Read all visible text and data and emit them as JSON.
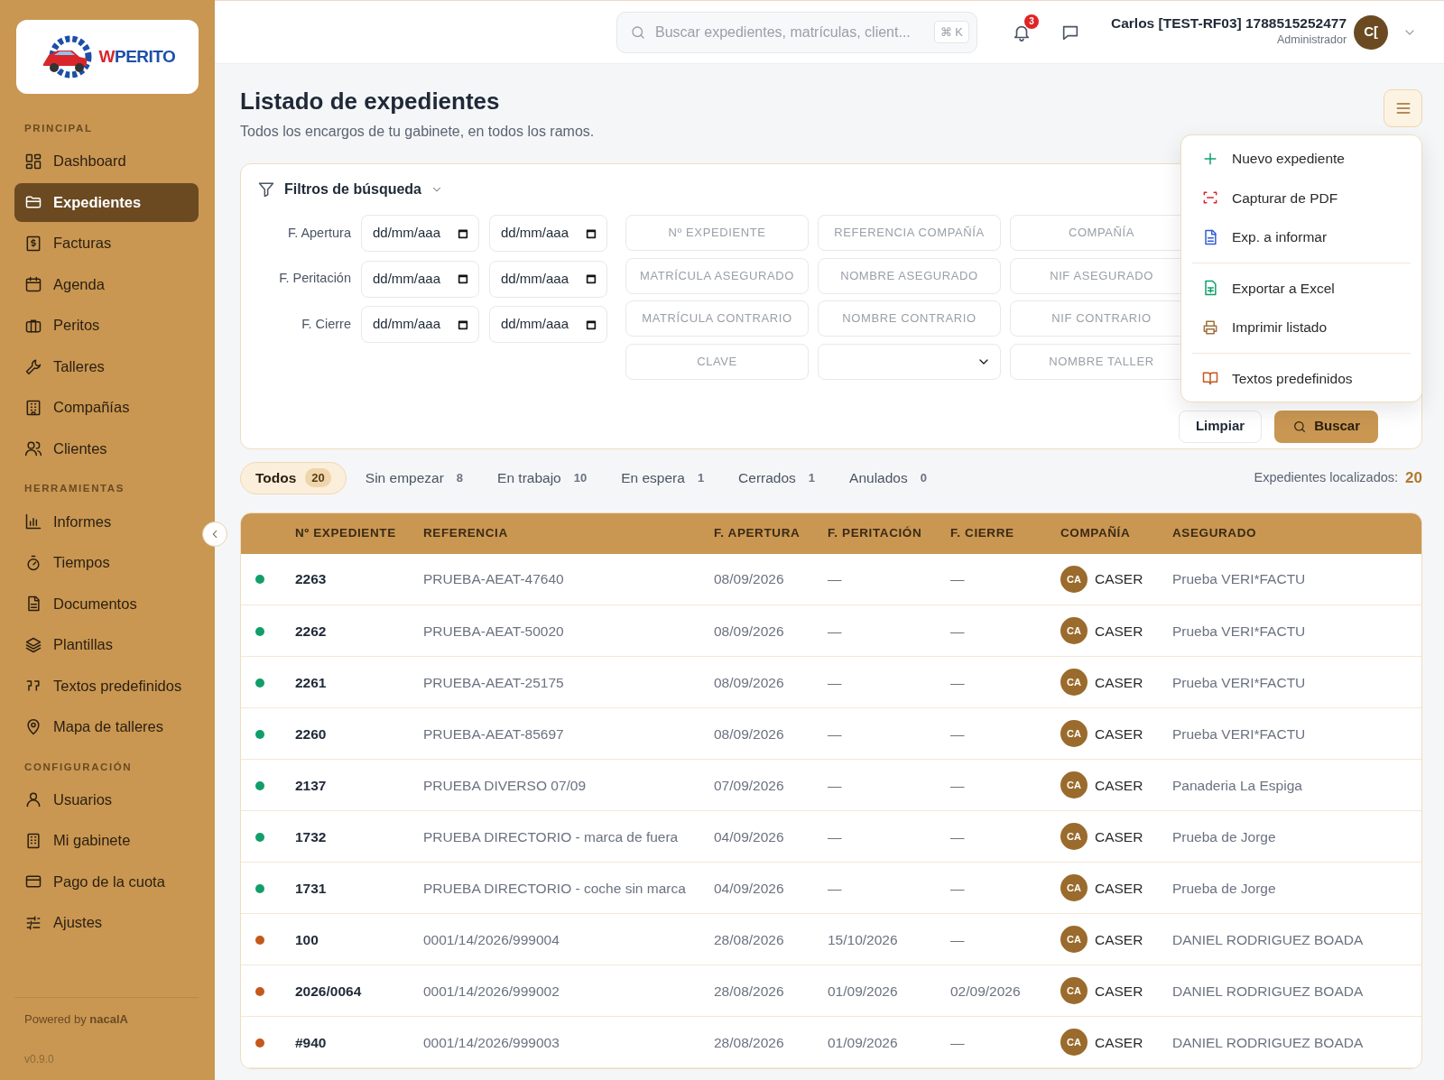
{
  "sidebar": {
    "logo": {
      "mark": "W",
      "text": "PERITO"
    },
    "sections": [
      {
        "title": "PRINCIPAL",
        "items": [
          {
            "label": "Dashboard",
            "selected": false
          },
          {
            "label": "Expedientes",
            "selected": true
          },
          {
            "label": "Facturas",
            "selected": false
          },
          {
            "label": "Agenda",
            "selected": false
          },
          {
            "label": "Peritos",
            "selected": false
          },
          {
            "label": "Talleres",
            "selected": false
          },
          {
            "label": "Compañías",
            "selected": false
          },
          {
            "label": "Clientes",
            "selected": false
          }
        ]
      },
      {
        "title": "HERRAMIENTAS",
        "items": [
          {
            "label": "Informes",
            "selected": false
          },
          {
            "label": "Tiempos",
            "selected": false
          },
          {
            "label": "Documentos",
            "selected": false
          },
          {
            "label": "Plantillas",
            "selected": false
          },
          {
            "label": "Textos predefinidos",
            "selected": false
          },
          {
            "label": "Mapa de talleres",
            "selected": false
          }
        ]
      },
      {
        "title": "CONFIGURACIÓN",
        "items": [
          {
            "label": "Usuarios",
            "selected": false
          },
          {
            "label": "Mi gabinete",
            "selected": false
          },
          {
            "label": "Pago de la cuota",
            "selected": false
          },
          {
            "label": "Ajustes",
            "selected": false
          }
        ]
      }
    ],
    "powered_by": "Powered by **nacalA**",
    "version": "v0.9.0"
  },
  "header": {
    "search": {
      "placeholder": "Buscar expedientes, matrículas, client...",
      "shortcut": "⌘ K"
    },
    "notifications": "3",
    "user": {
      "name": "Carlos [TEST-RF03] 1788515252477",
      "role": "Administrador",
      "initials": "C["
    }
  },
  "page": {
    "title": "Listado de expedientes",
    "subtitle": "Todos los encargos de tu gabinete, en todos los ramos."
  },
  "filters": {
    "title": "Filtros de búsqueda",
    "date_rows": [
      {
        "label": "F. Apertura",
        "from": "dd/mm/aaa",
        "to": "dd/mm/aaa"
      },
      {
        "label": "F. Peritación",
        "from": "dd/mm/aaa",
        "to": "dd/mm/aaa"
      },
      {
        "label": "F. Cierre",
        "from": "dd/mm/aaa",
        "to": "dd/mm/aaa"
      }
    ],
    "fields": [
      {
        "kind": "text",
        "placeholder": "Nº EXPEDIENTE"
      },
      {
        "kind": "text",
        "placeholder": "REFERENCIA COMPAÑÍA"
      },
      {
        "kind": "text",
        "placeholder": "COMPAÑÍA"
      },
      {
        "kind": "text",
        "placeholder": "MATRÍCULA ASEGURADO"
      },
      {
        "kind": "text",
        "placeholder": "NOMBRE ASEGURADO"
      },
      {
        "kind": "text",
        "placeholder": "NIF ASEGURADO"
      },
      {
        "kind": "text",
        "placeholder": "MATRÍCULA CONTRARIO"
      },
      {
        "kind": "text",
        "placeholder": "NOMBRE CONTRARIO"
      },
      {
        "kind": "text",
        "placeholder": "NIF CONTRARIO"
      },
      {
        "kind": "text",
        "placeholder": "CLAVE"
      },
      {
        "kind": "select"
      },
      {
        "kind": "text",
        "placeholder": "NOMBRE TALLER"
      }
    ],
    "buttons": [
      "Limpiar",
      "Buscar"
    ]
  },
  "actions_menu": {
    "groups": [
      [
        "Nuevo expediente",
        "Capturar de PDF",
        "Exp. a informar"
      ],
      [
        "Exportar a Excel",
        "Imprimir listado"
      ],
      [
        "Textos predefinidos"
      ]
    ]
  },
  "tabs": [
    {
      "label": "Todos",
      "count": "20",
      "selected": true
    },
    {
      "label": "Sin empezar",
      "count": "8",
      "selected": false
    },
    {
      "label": "En trabajo",
      "count": "10",
      "selected": false
    },
    {
      "label": "En espera",
      "count": "1",
      "selected": false
    },
    {
      "label": "Cerrados",
      "count": "1",
      "selected": false
    },
    {
      "label": "Anulados",
      "count": "0",
      "selected": false
    }
  ],
  "found": {
    "label": "Expedientes localizados:",
    "count": "20"
  },
  "table": {
    "columns": [
      "Nº EXPEDIENTE",
      "REFERENCIA",
      "F. APERTURA",
      "F. PERITACIÓN",
      "F. CIERRE",
      "COMPAÑÍA",
      "ASEGURADO"
    ],
    "rows": [
      {
        "color": "#129e6a",
        "number": "2263",
        "reference": "PRUEBA-AEAT-47640",
        "opened": "08/09/2026",
        "appraised": "—",
        "closed": "—",
        "company_initials": "CA",
        "company": "CASER",
        "insured": "Prueba VERI*FACTU"
      },
      {
        "color": "#129e6a",
        "number": "2262",
        "reference": "PRUEBA-AEAT-50020",
        "opened": "08/09/2026",
        "appraised": "—",
        "closed": "—",
        "company_initials": "CA",
        "company": "CASER",
        "insured": "Prueba VERI*FACTU"
      },
      {
        "color": "#129e6a",
        "number": "2261",
        "reference": "PRUEBA-AEAT-25175",
        "opened": "08/09/2026",
        "appraised": "—",
        "closed": "—",
        "company_initials": "CA",
        "company": "CASER",
        "insured": "Prueba VERI*FACTU"
      },
      {
        "color": "#129e6a",
        "number": "2260",
        "reference": "PRUEBA-AEAT-85697",
        "opened": "08/09/2026",
        "appraised": "—",
        "closed": "—",
        "company_initials": "CA",
        "company": "CASER",
        "insured": "Prueba VERI*FACTU"
      },
      {
        "color": "#129e6a",
        "number": "2137",
        "reference": "PRUEBA DIVERSO 07/09",
        "opened": "07/09/2026",
        "appraised": "—",
        "closed": "—",
        "company_initials": "CA",
        "company": "CASER",
        "insured": "Panaderia La Espiga"
      },
      {
        "color": "#129e6a",
        "number": "1732",
        "reference": "PRUEBA DIRECTORIO - marca de fuera",
        "opened": "04/09/2026",
        "appraised": "—",
        "closed": "—",
        "company_initials": "CA",
        "company": "CASER",
        "insured": "Prueba de Jorge"
      },
      {
        "color": "#129e6a",
        "number": "1731",
        "reference": "PRUEBA DIRECTORIO - coche sin marca",
        "opened": "04/09/2026",
        "appraised": "—",
        "closed": "—",
        "company_initials": "CA",
        "company": "CASER",
        "insured": "Prueba de Jorge"
      },
      {
        "color": "#c4581c",
        "number": "100",
        "reference": "0001/14/2026/999004",
        "opened": "28/08/2026",
        "appraised": "15/10/2026",
        "closed": "—",
        "company_initials": "CA",
        "company": "CASER",
        "insured": "DANIEL RODRIGUEZ BOADA"
      },
      {
        "color": "#c4581c",
        "number": "2026/0064",
        "reference": "0001/14/2026/999002",
        "opened": "28/08/2026",
        "appraised": "01/09/2026",
        "closed": "02/09/2026",
        "company_initials": "CA",
        "company": "CASER",
        "insured": "DANIEL RODRIGUEZ BOADA"
      },
      {
        "color": "#c4581c",
        "number": "#940",
        "reference": "0001/14/2026/999003",
        "opened": "28/08/2026",
        "appraised": "01/09/2026",
        "closed": "—",
        "company_initials": "CA",
        "company": "CASER",
        "insured": "DANIEL RODRIGUEZ BOADA"
      }
    ]
  }
}
